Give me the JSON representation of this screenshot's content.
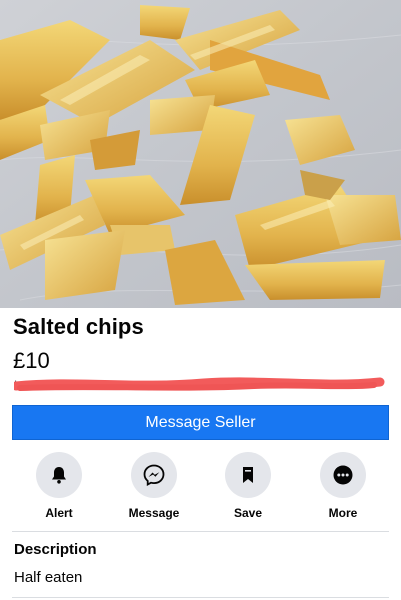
{
  "listing": {
    "title": "Salted chips",
    "price": "£10",
    "location_hidden": "Location redacted"
  },
  "buttons": {
    "message_seller": "Message Seller"
  },
  "actions": [
    {
      "label": "Alert",
      "icon": "bell-icon"
    },
    {
      "label": "Message",
      "icon": "messenger-icon"
    },
    {
      "label": "Save",
      "icon": "bookmark-icon"
    },
    {
      "label": "More",
      "icon": "more-icon"
    }
  ],
  "description": {
    "heading": "Description",
    "text": "Half eaten"
  },
  "colors": {
    "primary": "#1877f2",
    "redaction": "#f25b5b",
    "action_bg": "#e4e6eb"
  }
}
